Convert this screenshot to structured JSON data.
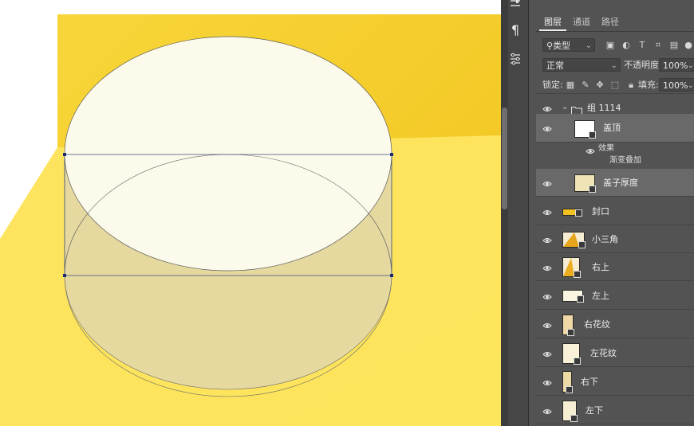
{
  "canvas": {
    "background_color": "#ffffff",
    "artboard_color": "#f6cf2c",
    "floor_color": "#fde45a",
    "lid_top_color": "#fcfaea",
    "lid_body_color": "#e6d9a0",
    "anchor_color": "#1c2c70"
  },
  "toolstrip": {
    "tools": [
      "sliders-icon",
      "paragraph-icon",
      "adjustments-icon"
    ]
  },
  "layers_panel": {
    "tabs": [
      "图层",
      "通道",
      "路径"
    ],
    "active_tab": "图层",
    "filter": {
      "label": "类型"
    },
    "blend_mode": "正常",
    "opacity_label": "不透明度:",
    "opacity_value": "100%",
    "lock_label": "锁定:",
    "fill_label": "填充:",
    "fill_value": "100%",
    "group": {
      "name": "组 1114"
    },
    "layers": [
      {
        "name": "盖顶",
        "selected": true,
        "thumb": "white",
        "effects": {
          "title": "效果",
          "items": [
            "渐变叠加"
          ]
        }
      },
      {
        "name": "盖子厚度",
        "selected": true,
        "thumb": "cream"
      },
      {
        "name": "封口",
        "selected": false,
        "thumb": "bar"
      },
      {
        "name": "小三角",
        "selected": false,
        "thumb": "triangle"
      },
      {
        "name": "右上",
        "selected": false,
        "thumb": "corner"
      },
      {
        "name": "左上",
        "selected": false,
        "thumb": "white"
      },
      {
        "name": "右花纹",
        "selected": false,
        "thumb": "tall"
      },
      {
        "name": "左花纹",
        "selected": false,
        "thumb": "cream"
      },
      {
        "name": "右下",
        "selected": false,
        "thumb": "narrow"
      },
      {
        "name": "左下",
        "selected": false,
        "thumb": "cream"
      }
    ]
  }
}
